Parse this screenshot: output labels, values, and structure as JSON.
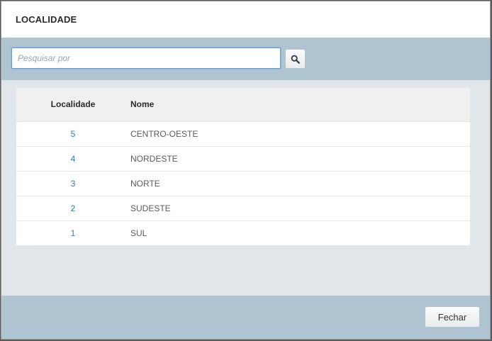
{
  "dialog": {
    "title": "LOCALIDADE"
  },
  "search": {
    "placeholder": "Pesquisar por",
    "value": "",
    "button_icon": "search-icon"
  },
  "table": {
    "headers": {
      "localidade": "Localidade",
      "nome": "Nome"
    },
    "rows": [
      {
        "localidade": "5",
        "nome": "CENTRO-OESTE"
      },
      {
        "localidade": "4",
        "nome": "NORDESTE"
      },
      {
        "localidade": "3",
        "nome": "NORTE"
      },
      {
        "localidade": "2",
        "nome": "SUDESTE"
      },
      {
        "localidade": "1",
        "nome": "SUL"
      }
    ]
  },
  "footer": {
    "close_label": "Fechar"
  },
  "colors": {
    "bar_bg": "#aec4d1",
    "body_bg": "#e1e6ea",
    "link": "#2f7db8"
  }
}
